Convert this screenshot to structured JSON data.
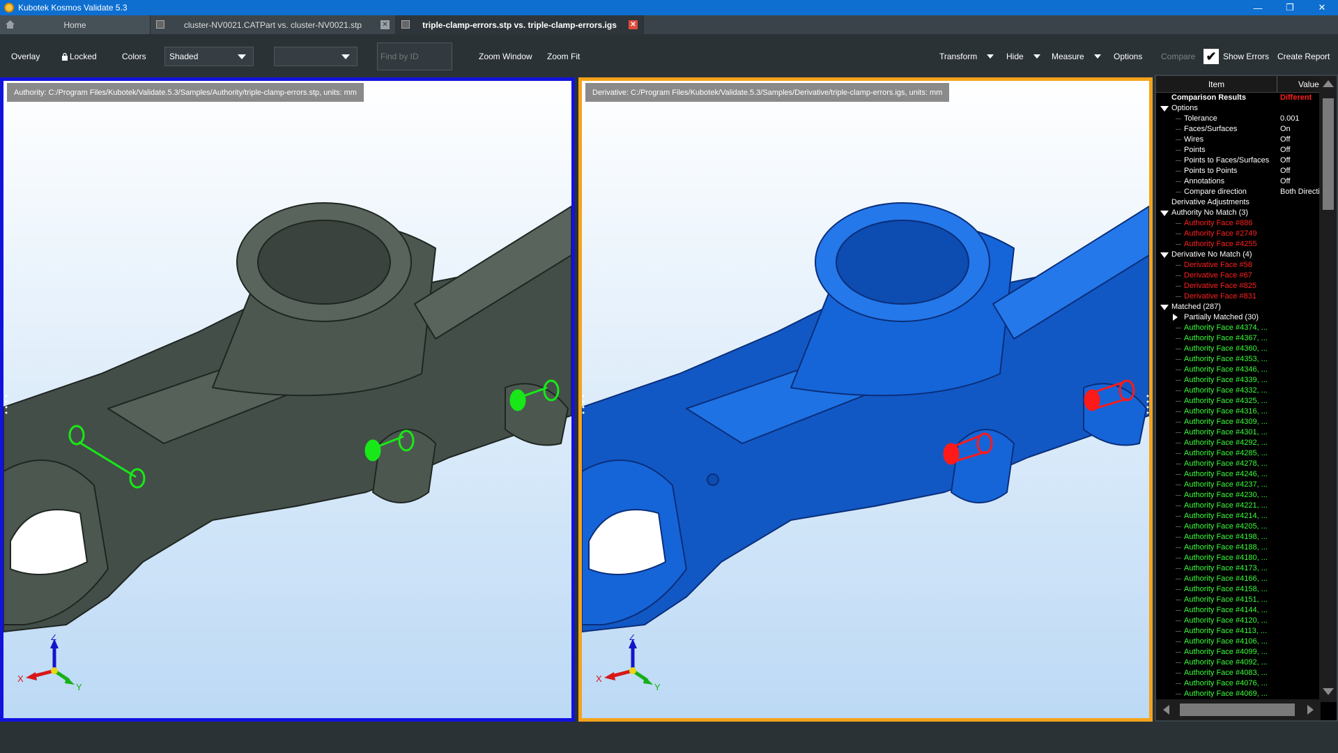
{
  "window": {
    "title": "Kubotek Kosmos Validate 5.3",
    "minimize_glyph": "—",
    "restore_glyph": "❐",
    "close_glyph": "✕"
  },
  "tabs": [
    {
      "label": "Home",
      "icon": "home-icon"
    },
    {
      "label": "cluster-NV0021.CATPart vs. cluster-NV0021.stp",
      "close": "✕"
    },
    {
      "label": "triple-clamp-errors.stp vs. triple-clamp-errors.igs",
      "close": "✕"
    }
  ],
  "toolbar": {
    "overlay": "Overlay",
    "locked": "Locked",
    "colors": "Colors",
    "display_mode": "Shaded",
    "second_select": "",
    "find_placeholder": "Find by ID",
    "zoom_window": "Zoom Window",
    "zoom_fit": "Zoom Fit",
    "transform": "Transform",
    "hide": "Hide",
    "measure": "Measure",
    "options": "Options",
    "compare": "Compare",
    "show_errors": "Show Errors",
    "show_errors_checked": true,
    "create_report": "Create Report"
  },
  "viewports": {
    "authority": {
      "path": "Authority:  C:/Program Files/Kubotek/Validate.5.3/Samples/Authority/triple-clamp-errors.stp, units: mm",
      "border_color": "#1212dd",
      "model_color": "#4c5750",
      "error_color": "#18e818"
    },
    "derivative": {
      "path": "Derivative:  C:/Program Files/Kubotek/Validate.5.3/Samples/Derivative/triple-clamp-errors.igs, units: mm",
      "border_color": "#f5a31b",
      "model_color": "#1565d8",
      "error_color": "#ff1a1a"
    },
    "axes": {
      "x": "X",
      "y": "Y",
      "z": "Z"
    }
  },
  "panel": {
    "col_item": "Item",
    "col_value": "Value",
    "rows": [
      {
        "level": 0,
        "label": "Comparison Results",
        "value": "Different",
        "color": "white",
        "bold": true,
        "value_color": "red"
      },
      {
        "level": 0,
        "label": "Options",
        "toggle": "down",
        "color": "white"
      },
      {
        "level": 1,
        "label": "Tolerance",
        "value": "0.001",
        "color": "white"
      },
      {
        "level": 1,
        "label": "Faces/Surfaces",
        "value": "On",
        "color": "white"
      },
      {
        "level": 1,
        "label": "Wires",
        "value": "Off",
        "color": "white"
      },
      {
        "level": 1,
        "label": "Points",
        "value": "Off",
        "color": "white"
      },
      {
        "level": 1,
        "label": "Points to Faces/Surfaces",
        "value": "Off",
        "color": "white"
      },
      {
        "level": 1,
        "label": "Points to Points",
        "value": "Off",
        "color": "white"
      },
      {
        "level": 1,
        "label": "Annotations",
        "value": "Off",
        "color": "white"
      },
      {
        "level": 1,
        "label": "Compare direction",
        "value": "Both Directions",
        "color": "white"
      },
      {
        "level": 0,
        "label": "Derivative Adjustments",
        "color": "white"
      },
      {
        "level": 0,
        "label": "Authority No Match (3)",
        "toggle": "down",
        "color": "white"
      },
      {
        "level": 1,
        "label": "Authority Face #886",
        "color": "red"
      },
      {
        "level": 1,
        "label": "Authority Face #2749",
        "color": "red"
      },
      {
        "level": 1,
        "label": "Authority Face #4255",
        "color": "red"
      },
      {
        "level": 0,
        "label": "Derivative No Match (4)",
        "toggle": "down",
        "color": "white"
      },
      {
        "level": 1,
        "label": "Derivative Face #58",
        "color": "red"
      },
      {
        "level": 1,
        "label": "Derivative Face #67",
        "color": "red"
      },
      {
        "level": 1,
        "label": "Derivative Face #825",
        "color": "red"
      },
      {
        "level": 1,
        "label": "Derivative Face #831",
        "color": "red"
      },
      {
        "level": 0,
        "label": "Matched (287)",
        "toggle": "down",
        "color": "white"
      },
      {
        "level": 1,
        "label": "Partially Matched (30)",
        "toggle": "right",
        "color": "white"
      },
      {
        "level": 1,
        "label": "Authority Face #4374, ...",
        "color": "green"
      },
      {
        "level": 1,
        "label": "Authority Face #4367, ...",
        "color": "green"
      },
      {
        "level": 1,
        "label": "Authority Face #4360, ...",
        "color": "green"
      },
      {
        "level": 1,
        "label": "Authority Face #4353, ...",
        "color": "green"
      },
      {
        "level": 1,
        "label": "Authority Face #4346, ...",
        "color": "green"
      },
      {
        "level": 1,
        "label": "Authority Face #4339, ...",
        "color": "green"
      },
      {
        "level": 1,
        "label": "Authority Face #4332, ...",
        "color": "green"
      },
      {
        "level": 1,
        "label": "Authority Face #4325, ...",
        "color": "green"
      },
      {
        "level": 1,
        "label": "Authority Face #4316, ...",
        "color": "green"
      },
      {
        "level": 1,
        "label": "Authority Face #4309, ...",
        "color": "green"
      },
      {
        "level": 1,
        "label": "Authority Face #4301, ...",
        "color": "green"
      },
      {
        "level": 1,
        "label": "Authority Face #4292, ...",
        "color": "green"
      },
      {
        "level": 1,
        "label": "Authority Face #4285, ...",
        "color": "green"
      },
      {
        "level": 1,
        "label": "Authority Face #4278, ...",
        "color": "green"
      },
      {
        "level": 1,
        "label": "Authority Face #4246, ...",
        "color": "green"
      },
      {
        "level": 1,
        "label": "Authority Face #4237, ...",
        "color": "green"
      },
      {
        "level": 1,
        "label": "Authority Face #4230, ...",
        "color": "green"
      },
      {
        "level": 1,
        "label": "Authority Face #4221, ...",
        "color": "green"
      },
      {
        "level": 1,
        "label": "Authority Face #4214, ...",
        "color": "green"
      },
      {
        "level": 1,
        "label": "Authority Face #4205, ...",
        "color": "green"
      },
      {
        "level": 1,
        "label": "Authority Face #4198, ...",
        "color": "green"
      },
      {
        "level": 1,
        "label": "Authority Face #4188, ...",
        "color": "green"
      },
      {
        "level": 1,
        "label": "Authority Face #4180, ...",
        "color": "green"
      },
      {
        "level": 1,
        "label": "Authority Face #4173, ...",
        "color": "green"
      },
      {
        "level": 1,
        "label": "Authority Face #4166, ...",
        "color": "green"
      },
      {
        "level": 1,
        "label": "Authority Face #4158, ...",
        "color": "green"
      },
      {
        "level": 1,
        "label": "Authority Face #4151, ...",
        "color": "green"
      },
      {
        "level": 1,
        "label": "Authority Face #4144, ...",
        "color": "green"
      },
      {
        "level": 1,
        "label": "Authority Face #4120, ...",
        "color": "green"
      },
      {
        "level": 1,
        "label": "Authority Face #4113, ...",
        "color": "green"
      },
      {
        "level": 1,
        "label": "Authority Face #4106, ...",
        "color": "green"
      },
      {
        "level": 1,
        "label": "Authority Face #4099, ...",
        "color": "green"
      },
      {
        "level": 1,
        "label": "Authority Face #4092, ...",
        "color": "green"
      },
      {
        "level": 1,
        "label": "Authority Face #4083, ...",
        "color": "green"
      },
      {
        "level": 1,
        "label": "Authority Face #4076, ...",
        "color": "green"
      },
      {
        "level": 1,
        "label": "Authority Face #4069, ...",
        "color": "green"
      }
    ]
  }
}
